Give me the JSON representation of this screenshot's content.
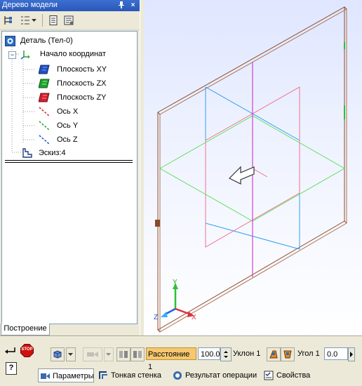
{
  "tree_panel": {
    "title": "Дерево модели",
    "pin_icon": "pin-icon",
    "close_label": "×",
    "tab": "Построение",
    "items": [
      {
        "label": "Деталь (Тел-0)",
        "icon": "part-icon"
      },
      {
        "label": "Начало координат",
        "icon": "origin-icon",
        "expander": "−"
      },
      {
        "label": "Плоскость XY",
        "icon": "plane-xy-icon"
      },
      {
        "label": "Плоскость ZX",
        "icon": "plane-zx-icon"
      },
      {
        "label": "Плоскость ZY",
        "icon": "plane-zy-icon"
      },
      {
        "label": "Ось X",
        "icon": "axis-x-icon"
      },
      {
        "label": "Ось Y",
        "icon": "axis-y-icon"
      },
      {
        "label": "Ось Z",
        "icon": "axis-z-icon"
      },
      {
        "label": "Эскиз:4",
        "icon": "sketch-icon"
      }
    ]
  },
  "viewport": {
    "triad": {
      "x": "X",
      "y": "Y",
      "z": "Z"
    },
    "colors": {
      "plane_frame": "#8a4a2a",
      "axis_x": "#e03040",
      "axis_y": "#30c030",
      "axis_z": "#2060e0",
      "guide_blue": "#30a0f0",
      "guide_pink": "#f07090",
      "guide_green": "#60e060",
      "guide_magenta": "#d040d0"
    }
  },
  "properties": {
    "distance_label": "Расстояние 1",
    "distance_value": "100.0",
    "slope_label": "Уклон 1",
    "angle_label": "Угол 1",
    "angle_value": "0.0"
  },
  "bottom_tabs": [
    {
      "label": "Параметры",
      "icon": "parameters-icon"
    },
    {
      "label": "Тонкая стенка",
      "icon": "thin-wall-icon"
    },
    {
      "label": "Результат операции",
      "icon": "operation-result-icon"
    },
    {
      "label": "Свойства",
      "icon": "properties-icon"
    }
  ],
  "stop_label": "STOP",
  "help_label": "?"
}
